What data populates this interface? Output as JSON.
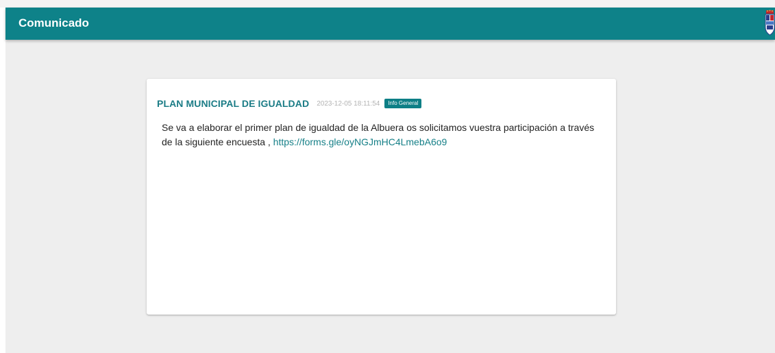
{
  "toolbar": {
    "title": "Comunicado",
    "logo_icon": "coat-of-arms-icon"
  },
  "notice": {
    "title": "PLAN MUNICIPAL DE IGUALDAD",
    "date": "2023-12-05 18:11:54",
    "category": "Info General",
    "body_text": "Se va a elaborar el primer plan de igualdad de la Albuera os solicitamos vuestra participación a través de la siguiente encuesta , ",
    "link_text": "https://forms.gle/oyNGJmHC4LmebA6o9"
  },
  "colors": {
    "primary": "#0e8289",
    "badge": "#0e7f86",
    "title": "#1b7c86",
    "background": "#eeeeee"
  }
}
